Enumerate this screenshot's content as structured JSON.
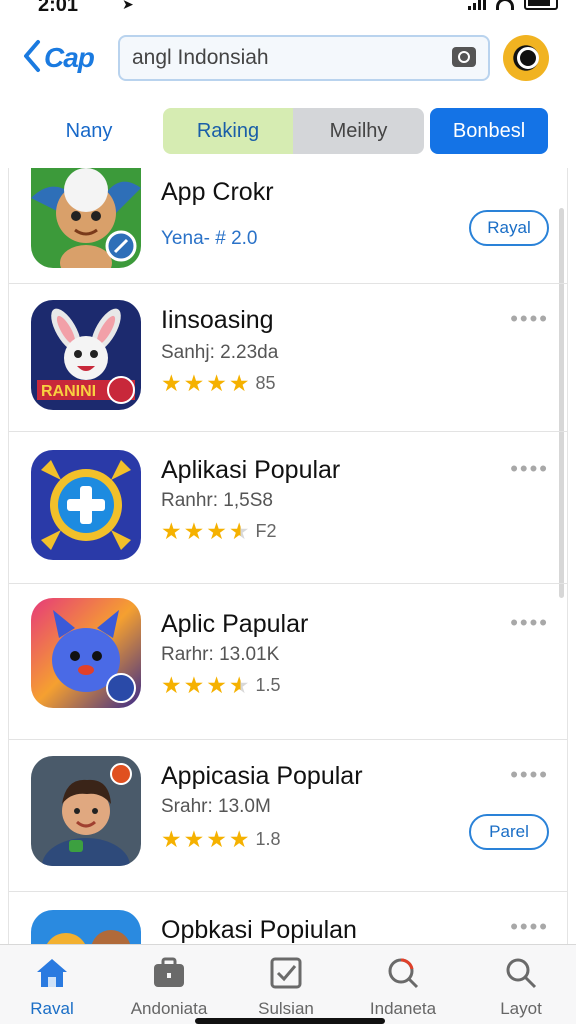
{
  "status_bar": {
    "time": "2:01",
    "nav_glyph": "➤"
  },
  "header": {
    "logo_text": "Cap",
    "search_value": "angl Indonsiah"
  },
  "tabs": [
    "Nany",
    "Raking",
    "Meilhy",
    "Bonbesl"
  ],
  "apps": [
    {
      "title": "App Crokr",
      "meta": "Yena- # 2.0",
      "rating_text": "",
      "stars": 0,
      "action_label": "Rayal",
      "has_more": false,
      "icon": "cartoon-monkey-icon"
    },
    {
      "title": "Iinsoasing",
      "meta": "Sanhj: 2.23da",
      "rating_text": "85",
      "stars": 4,
      "action_label": "",
      "has_more": true,
      "icon": "bunny-game-icon"
    },
    {
      "title": "Aplikasi Popular",
      "meta": "Ranhr: 1,5S8",
      "rating_text": "F2",
      "stars": 3.5,
      "action_label": "",
      "has_more": true,
      "icon": "plus-gear-icon"
    },
    {
      "title": "Aplic Papular",
      "meta": "Rarhr: 13.01K",
      "rating_text": "1.5",
      "stars": 3.5,
      "action_label": "",
      "has_more": true,
      "icon": "blue-creature-icon"
    },
    {
      "title": "Appicasia Popular",
      "meta": "Srahr: 13.0M",
      "rating_text": "1.8",
      "stars": 4,
      "action_label": "Parel",
      "has_more": true,
      "icon": "boy-portrait-icon"
    },
    {
      "title": "Opbkasi Popiulan",
      "meta": "",
      "rating_text": "",
      "stars": 0,
      "action_label": "",
      "has_more": true,
      "icon": "animals-icon"
    }
  ],
  "more_glyph": "••••",
  "bottom_nav": [
    {
      "label": "Raval",
      "icon": "home-icon"
    },
    {
      "label": "Andoniata",
      "icon": "briefcase-icon"
    },
    {
      "label": "Sulsian",
      "icon": "checkbox-icon"
    },
    {
      "label": "Indaneta",
      "icon": "explore-icon"
    },
    {
      "label": "Layot",
      "icon": "search-icon"
    }
  ],
  "colors": {
    "accent": "#1473e6",
    "star": "#f5b100",
    "ranking_tab": "#d6ecb2"
  }
}
